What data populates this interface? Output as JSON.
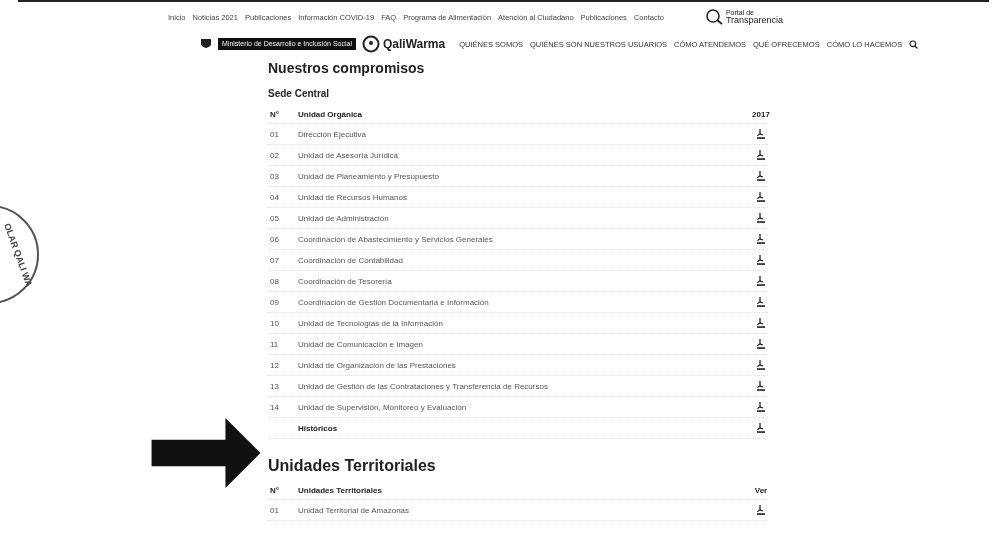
{
  "top_nav": [
    "Inicio",
    "Noticias 2021",
    "Publicaciones",
    "Información COVID-19",
    "FAQ",
    "Programa de Alimentación",
    "Atención al Ciudadano",
    "Publicaciones",
    "Contacto"
  ],
  "transparency_logo": {
    "small": "Portal de",
    "big": "Transparencia"
  },
  "header": {
    "ministry": "Ministerio de Desarrollo e Inclusión Social",
    "brand": "QaliWarma",
    "nav": [
      "QUIÉNES SOMOS",
      "QUIÉNES SON NUESTROS USUARIOS",
      "CÓMO ATENDEMOS",
      "QUÉ OFRECEMOS",
      "CÓMO LO HACEMOS"
    ]
  },
  "title": "Nuestros compromisos",
  "sections": [
    {
      "title": "Sede Central",
      "columns": [
        "N°",
        "Unidad Orgánica",
        "2017"
      ],
      "rows": [
        {
          "number": "01",
          "name": "Dirección Ejecutiva"
        },
        {
          "number": "02",
          "name": "Unidad de Asesoría Jurídica"
        },
        {
          "number": "03",
          "name": "Unidad de Planeamiento y Presupuesto"
        },
        {
          "number": "04",
          "name": "Unidad de Recursos Humanos"
        },
        {
          "number": "05",
          "name": "Unidad de Administración"
        },
        {
          "number": "06",
          "name": "Coordinación de Abastecimiento y Servicios Generales"
        },
        {
          "number": "07",
          "name": "Coordinación de Contabilidad"
        },
        {
          "number": "08",
          "name": "Coordinación de Tesorería"
        },
        {
          "number": "09",
          "name": "Coordinación de Gestión Documentaria e Información"
        },
        {
          "number": "10",
          "name": "Unidad de Tecnologías de la Información"
        },
        {
          "number": "11",
          "name": "Unidad de Comunicación e Imagen"
        },
        {
          "number": "12",
          "name": "Unidad de Organización de las Prestaciones"
        },
        {
          "number": "13",
          "name": "Unidad de Gestión de las Contrataciones y Transferencia de Recursos"
        },
        {
          "number": "14",
          "name": "Unidad de Supervisión, Monitoreo y Evaluación"
        },
        {
          "number": "",
          "name": "Históricos"
        }
      ]
    },
    {
      "title": "Unidades Territoriales",
      "columns": [
        "N°",
        "Unidades Territoriales",
        "Ver"
      ],
      "rows": [
        {
          "number": "01",
          "name": "Unidad Territorial de Amazonas"
        }
      ]
    }
  ],
  "stamp": "OLAR QALI WA"
}
